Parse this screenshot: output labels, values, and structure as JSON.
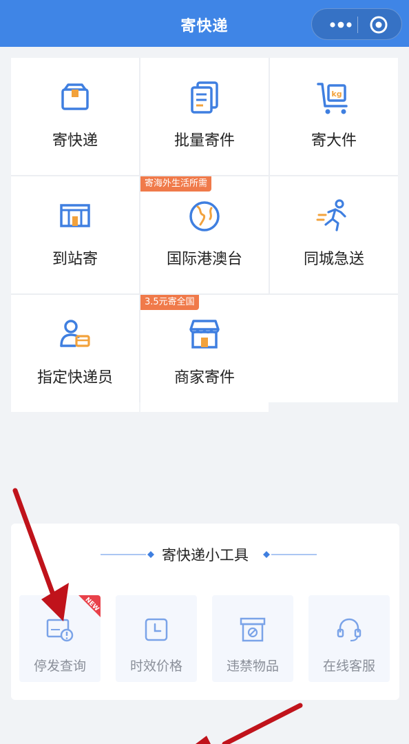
{
  "header": {
    "title": "寄快递",
    "more_icon": "more-dots-icon",
    "close_icon": "target-close-icon"
  },
  "grid": {
    "items": [
      {
        "label": "寄快递",
        "icon": "parcel-box-icon"
      },
      {
        "label": "批量寄件",
        "icon": "document-stack-icon"
      },
      {
        "label": "寄大件",
        "icon": "kg-cart-icon"
      },
      {
        "label": "到站寄",
        "icon": "station-icon",
        "badge": ""
      },
      {
        "label": "国际港澳台",
        "icon": "globe-icon",
        "badge": "寄海外生活所需"
      },
      {
        "label": "同城急送",
        "icon": "running-courier-icon"
      },
      {
        "label": "指定快递员",
        "icon": "courier-person-icon"
      },
      {
        "label": "商家寄件",
        "icon": "storefront-icon",
        "badge": "3.5元寄全国"
      }
    ]
  },
  "tools": {
    "title": "寄快递小工具",
    "new_badge": "NEW",
    "items": [
      {
        "label": "停发查询",
        "icon": "suspension-check-icon"
      },
      {
        "label": "时效价格",
        "icon": "clock-icon"
      },
      {
        "label": "违禁物品",
        "icon": "prohibited-box-icon"
      },
      {
        "label": "在线客服",
        "icon": "headset-icon"
      }
    ]
  },
  "colors": {
    "header": "#3f85e6",
    "icon_blue": "#3f7fe0",
    "icon_orange": "#f2a23c",
    "badge": "#f07a4a",
    "annotation_arrow": "#c0131b"
  }
}
